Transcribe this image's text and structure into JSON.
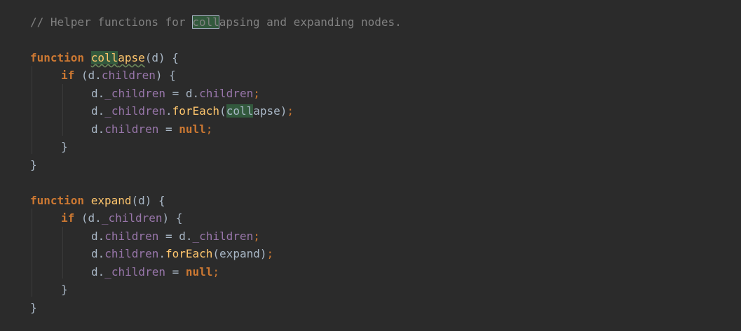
{
  "editor": {
    "language": "javascript",
    "search_term": "coll",
    "lines": [
      {
        "comment_a": "// Helper functions for ",
        "comment_hl": "coll",
        "comment_b": "apsing and expanding nodes."
      },
      {
        "kw": "function",
        "name_hl": "coll",
        "name_rest": "apse",
        "params": "(d) {"
      },
      {
        "kw": "if",
        "cond_a": "(d.",
        "cond_prop": "children",
        "cond_b": ") {"
      },
      {
        "a": "d.",
        "prop": "_children",
        "eq": " = d.",
        "prop2": "children",
        "semi": ";"
      },
      {
        "a": "d.",
        "prop": "_children",
        "dot": ".",
        "method": "forEach",
        "open": "(",
        "arg_hl": "coll",
        "arg_rest": "apse",
        "close": ")",
        "semi": ";"
      },
      {
        "a": "d.",
        "prop": "children",
        "eq": " = ",
        "val": "null",
        "semi": ";"
      },
      {
        "brace": "}"
      },
      {
        "brace": "}"
      },
      {
        "kw": "function",
        "name": "expand",
        "params": "(d) {"
      },
      {
        "kw": "if",
        "cond_a": "(d.",
        "cond_prop": "_children",
        "cond_b": ") {"
      },
      {
        "a": "d.",
        "prop": "children",
        "eq": " = d.",
        "prop2": "_children",
        "semi": ";"
      },
      {
        "a": "d.",
        "prop": "children",
        "dot": ".",
        "method": "forEach",
        "open": "(",
        "arg": "expand",
        "close": ")",
        "semi": ";"
      },
      {
        "a": "d.",
        "prop": "_children",
        "eq": " = ",
        "val": "null",
        "semi": ";"
      },
      {
        "brace": "}"
      },
      {
        "brace": "}"
      }
    ]
  }
}
